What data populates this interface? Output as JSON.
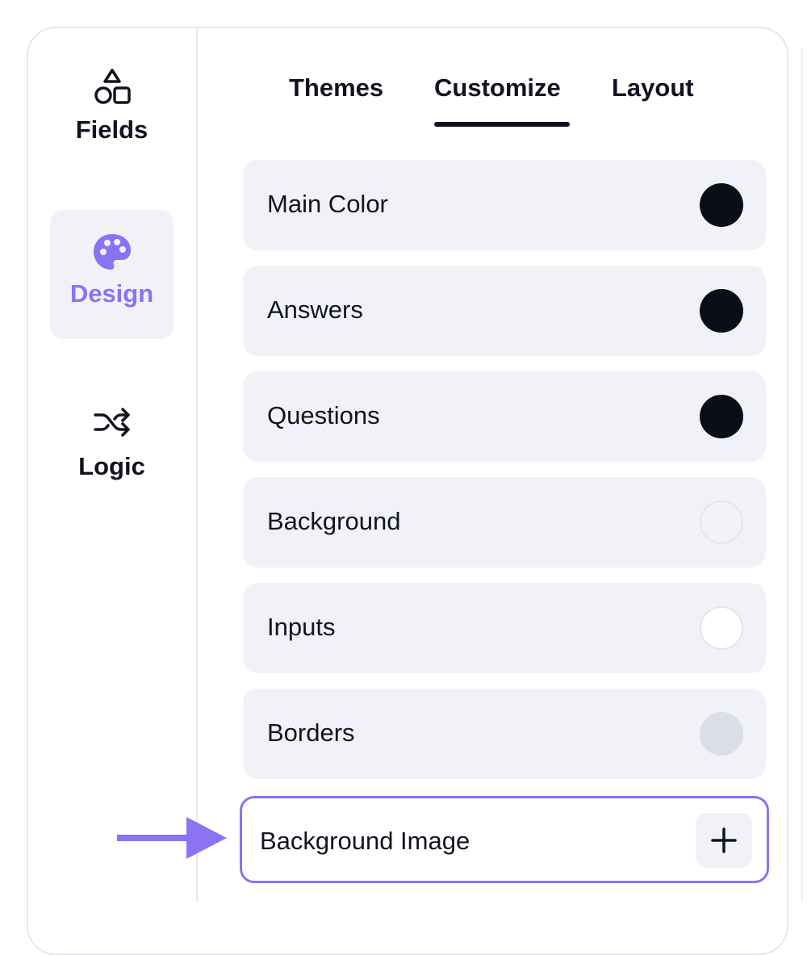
{
  "sidebar": {
    "items": [
      {
        "label": "Fields",
        "icon": "shapes-icon",
        "active": false
      },
      {
        "label": "Design",
        "icon": "palette-icon",
        "active": true
      },
      {
        "label": "Logic",
        "icon": "shuffle-icon",
        "active": false
      }
    ]
  },
  "tabs": [
    {
      "label": "Themes",
      "active": false
    },
    {
      "label": "Customize",
      "active": true
    },
    {
      "label": "Layout",
      "active": false
    }
  ],
  "customize": {
    "rows": [
      {
        "label": "Main Color",
        "color": "#0b0d18"
      },
      {
        "label": "Answers",
        "color": "#0b0d18"
      },
      {
        "label": "Questions",
        "color": "#0b0d18"
      },
      {
        "label": "Background",
        "color": "#f1f2f7"
      },
      {
        "label": "Inputs",
        "color": "#ffffff"
      },
      {
        "label": "Borders",
        "color": "#dcdee5"
      }
    ],
    "background_image": {
      "label": "Background Image",
      "button_icon": "plus-icon"
    }
  },
  "colors": {
    "accent": "#8b73f4",
    "text": "#111322",
    "row_bg": "#f1f2f7"
  }
}
